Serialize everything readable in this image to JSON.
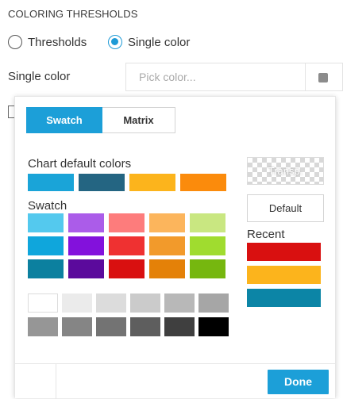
{
  "section": {
    "title": "COLORING THRESHOLDS"
  },
  "mode": {
    "options": [
      {
        "label": "Thresholds",
        "selected": false
      },
      {
        "label": "Single color",
        "selected": true
      }
    ]
  },
  "single_color": {
    "label": "Single color",
    "placeholder": "Pick color..."
  },
  "picker": {
    "tabs": [
      {
        "label": "Swatch",
        "active": true
      },
      {
        "label": "Matrix",
        "active": false
      }
    ],
    "chart_default": {
      "label": "Chart default colors",
      "colors": [
        "#1aa4d8",
        "#246582",
        "#fcb41c",
        "#fb8b0c"
      ]
    },
    "swatch": {
      "label": "Swatch",
      "rows": [
        [
          "#54c9ee",
          "#ab5ce9",
          "#fd7c7c",
          "#fcb55c",
          "#c9e781"
        ],
        [
          "#0fa6dc",
          "#8311dc",
          "#ef3131",
          "#f29a2b",
          "#a0dc2f"
        ],
        [
          "#0c809f",
          "#5b0a9c",
          "#d91010",
          "#e48108",
          "#76b70f"
        ]
      ],
      "grays": [
        [
          "#ffffff",
          "#ebebeb",
          "#dcdcdc",
          "#cbcbcb",
          "#b8b8b8",
          "#a6a6a6"
        ],
        [
          "#969696",
          "#858585",
          "#737373",
          "#5e5e5e",
          "#3f3f3f",
          "#000000"
        ]
      ]
    },
    "transparent_label": "Transp.",
    "default_label": "Default",
    "recent": {
      "label": "Recent",
      "colors": [
        "#d91010",
        "#fcb41c",
        "#0c85a6"
      ]
    },
    "done_label": "Done"
  }
}
